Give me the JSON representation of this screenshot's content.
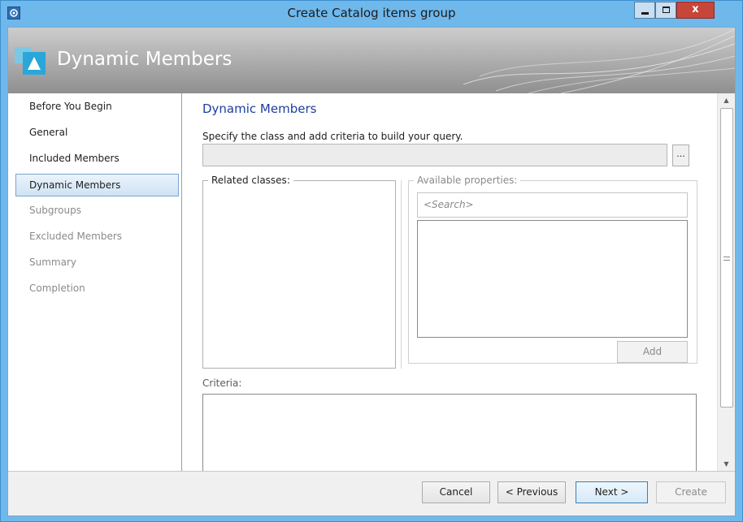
{
  "window": {
    "title": "Create Catalog items group",
    "icon": "app-icon",
    "controls": [
      "minimize-icon",
      "maximize-icon",
      "close-icon"
    ]
  },
  "banner": {
    "title": "Dynamic Members",
    "icon": "group-icon"
  },
  "sidebar": {
    "items": [
      {
        "label": "Before You Begin",
        "state": "done"
      },
      {
        "label": "General",
        "state": "done"
      },
      {
        "label": "Included Members",
        "state": "done"
      },
      {
        "label": "Dynamic Members",
        "state": "selected"
      },
      {
        "label": "Subgroups",
        "state": "pending"
      },
      {
        "label": "Excluded Members",
        "state": "pending"
      },
      {
        "label": "Summary",
        "state": "pending"
      },
      {
        "label": "Completion",
        "state": "pending"
      }
    ]
  },
  "main": {
    "title": "Dynamic Members",
    "instruction": "Specify the class and add criteria to build your query.",
    "class_value": "",
    "browse_label": "...",
    "related_classes_label": "Related classes:",
    "available_properties_label": "Available properties:",
    "search_placeholder": "<Search>",
    "add_label": "Add",
    "criteria_label": "Criteria:"
  },
  "footer": {
    "cancel": "Cancel",
    "previous": "< Previous",
    "next": "Next >",
    "create": "Create"
  },
  "colors": {
    "title_bar": "#6fb8ec",
    "content_title": "#1e3e9e",
    "selected_nav": "#cfe3f4",
    "close_button": "#c7463a"
  }
}
